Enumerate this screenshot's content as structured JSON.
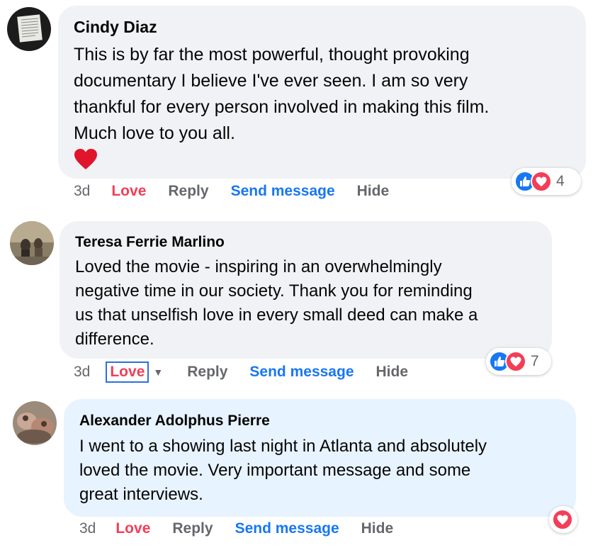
{
  "comments": [
    {
      "author": "Cindy Diaz",
      "text": "This is by far the most powerful, thought provoking\ndocumentary I believe I've ever seen. I am so very\nthankful for every person involved in making this film.\nMuch love to you all.",
      "time": "3d",
      "love_label": "Love",
      "reply_label": "Reply",
      "send_label": "Send message",
      "hide_label": "Hide",
      "reaction_count": "4"
    },
    {
      "author": "Teresa Ferrie Marlino",
      "text": "Loved the movie - inspiring in an overwhelmingly\nnegative time in our society. Thank you for reminding\nus that unselfish love in every small deed can make a\ndifference.",
      "time": "3d",
      "love_label": "Love",
      "reply_label": "Reply",
      "send_label": "Send message",
      "hide_label": "Hide",
      "reaction_count": "7"
    },
    {
      "author": "Alexander Adolphus Pierre",
      "text": "I went to a showing last night in Atlanta and absolutely\nloved the movie. Very important message and some\ngreat interviews.",
      "time": "3d",
      "love_label": "Love",
      "reply_label": "Reply",
      "send_label": "Send message",
      "hide_label": "Hide"
    }
  ],
  "colors": {
    "love": "#f33e58",
    "link": "#1877f2",
    "muted": "#65676b",
    "bubble_gray": "#f0f2f5",
    "bubble_blue": "#e7f3ff"
  }
}
